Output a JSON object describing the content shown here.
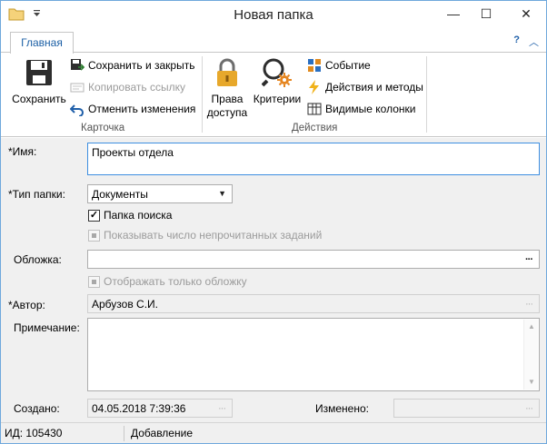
{
  "window": {
    "title": "Новая папка",
    "minimize_glyph": "—",
    "maximize_glyph": "☐",
    "close_glyph": "✕"
  },
  "ribbon": {
    "tabs": [
      {
        "label": "Главная",
        "active": true
      }
    ],
    "right_controls": {
      "help_glyph": "?",
      "collapse_glyph": "︿"
    },
    "groups": [
      {
        "caption": "Карточка",
        "big_buttons": [
          {
            "label": "Сохранить",
            "icon": "floppy-disk-icon"
          }
        ],
        "small_buttons": [
          {
            "label": "Сохранить и закрыть",
            "icon": "save-close-icon",
            "enabled": true
          },
          {
            "label": "Копировать ссылку",
            "icon": "copy-link-icon",
            "enabled": false
          },
          {
            "label": "Отменить изменения",
            "icon": "undo-icon",
            "enabled": true
          }
        ]
      },
      {
        "caption": "Действия",
        "big_buttons": [
          {
            "label_line1": "Права",
            "label_line2": "доступа",
            "icon": "lock-icon"
          },
          {
            "label": "Критерии",
            "icon": "magnifier-gear-icon"
          }
        ],
        "small_buttons": [
          {
            "label": "Событие",
            "icon": "event-blocks-icon",
            "enabled": true
          },
          {
            "label": "Действия и методы",
            "icon": "lightning-icon",
            "enabled": true
          },
          {
            "label": "Видимые колонки",
            "icon": "columns-icon",
            "enabled": true
          }
        ]
      }
    ]
  },
  "form": {
    "name": {
      "label": "*Имя:",
      "value": "Проекты отдела"
    },
    "folder_type": {
      "label": "*Тип папки:",
      "value": "Документы"
    },
    "search_folder": {
      "label": "Папка поиска",
      "checked": true
    },
    "show_unread": {
      "label": "Показывать число непрочитанных заданий",
      "enabled": false
    },
    "cover": {
      "label": "Обложка:",
      "value": "",
      "button": "···"
    },
    "cover_only": {
      "label": "Отображать только обложку",
      "enabled": false
    },
    "author": {
      "label": "*Автор:",
      "value": "Арбузов С.И.",
      "button": "···"
    },
    "note": {
      "label": "Примечание:",
      "value": ""
    },
    "created": {
      "label": "Создано:",
      "value": "04.05.2018 7:39:36",
      "button": "···"
    },
    "modified": {
      "label": "Изменено:",
      "value": "",
      "button": "···"
    }
  },
  "statusbar": {
    "id_text": "ИД: 105430",
    "mode": "Добавление"
  }
}
